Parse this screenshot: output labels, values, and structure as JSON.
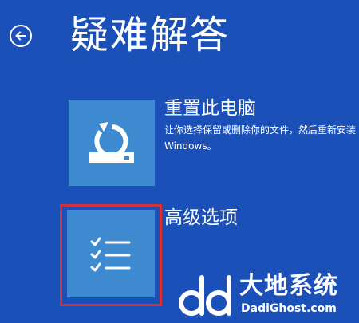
{
  "page": {
    "title": "疑难解答"
  },
  "options": [
    {
      "title": "重置此电脑",
      "description": "让你选择保留或删除你的文件，然后重新安装 Windows。",
      "icon": "reset-pc-icon"
    },
    {
      "title": "高级选项",
      "description": "",
      "icon": "checklist-icon"
    }
  ],
  "colors": {
    "background": "#1a50b8",
    "tile": "#3d8ad0",
    "highlight": "#d8303a"
  },
  "watermark": {
    "brand_cn": "大地系统",
    "brand_en": "DadiGhost.com",
    "icon": "dd-logo-icon"
  }
}
